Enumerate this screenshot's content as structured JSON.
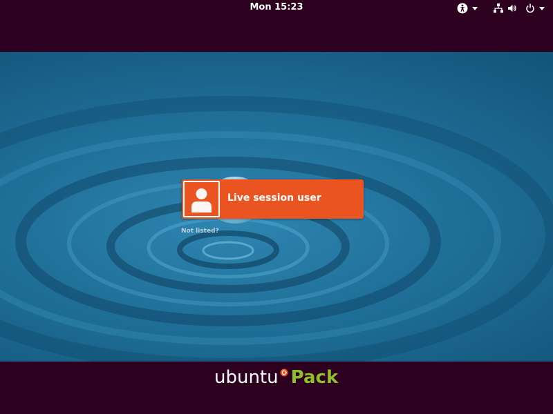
{
  "topbar": {
    "clock": "Mon 15:23",
    "icons": [
      "accessibility-icon",
      "network-icon",
      "volume-icon",
      "power-icon"
    ]
  },
  "login": {
    "user_name": "Live session user",
    "not_listed": "Not listed?",
    "avatar_icon": "user-avatar-icon"
  },
  "branding": {
    "logo_word": "ubuntu",
    "logo_suffix": "Pack"
  },
  "colors": {
    "panel": "#2c001e",
    "accent": "#e95420",
    "wallpaper": "#1f6f98",
    "pack_green": "#8fbf2b"
  }
}
